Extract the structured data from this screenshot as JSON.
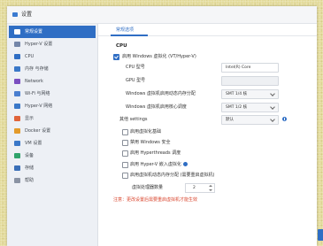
{
  "window": {
    "title": "设置"
  },
  "sidebar": {
    "items": [
      {
        "label": "常规设置",
        "icon": "settings-icon",
        "icon_color": "#ffffff",
        "active": true
      },
      {
        "label": "Hyper-V 设置",
        "icon": "hyperv-icon",
        "icon_color": "#7486a8",
        "active": false
      },
      {
        "label": "CPU",
        "icon": "cpu-icon",
        "icon_color": "#2f6ec4",
        "active": false
      },
      {
        "label": "内存 与存储",
        "icon": "memory-icon",
        "icon_color": "#3a78c8",
        "active": false
      },
      {
        "label": "Network",
        "icon": "network-icon",
        "icon_color": "#7b4fc0",
        "active": false
      },
      {
        "label": "Wi-Fi 与网络",
        "icon": "wifi-icon",
        "icon_color": "#4a7fd0",
        "active": false
      },
      {
        "label": "Hyper-V 网络",
        "icon": "network-adapter-icon",
        "icon_color": "#3a78c8",
        "active": false
      },
      {
        "label": "显示",
        "icon": "display-icon",
        "icon_color": "#e0643a",
        "active": false
      },
      {
        "label": "Docker 设置",
        "icon": "docker-icon",
        "icon_color": "#e39a2a",
        "active": false
      },
      {
        "label": "VM 设置",
        "icon": "vm-icon",
        "icon_color": "#3a78c8",
        "active": false
      },
      {
        "label": "设备",
        "icon": "devices-icon",
        "icon_color": "#2fa36b",
        "active": false
      },
      {
        "label": "存储",
        "icon": "storage-icon",
        "icon_color": "#3a6fb8",
        "active": false
      },
      {
        "label": "帮助",
        "icon": "help-icon",
        "icon_color": "#8a93a3",
        "active": false
      }
    ]
  },
  "main": {
    "tabs": [
      {
        "label": "常规选项",
        "active": true
      }
    ],
    "section_title": "CPU",
    "enable_virtualization": {
      "label": "启用 Windows 虚拟化 (VT/Hyper-V)",
      "checked": true
    },
    "fields": [
      {
        "label": "CPU 型号",
        "value": "Intel(R) Core"
      },
      {
        "label": "GPU 型号",
        "value": ""
      },
      {
        "label": "Windows 虚拟机启用动态内存分配",
        "value": "SMT 1/4 核"
      },
      {
        "label": "Windows 虚拟机启用核心调度",
        "value": "SMT 1/2 核"
      }
    ],
    "other": {
      "label": "其他 settings",
      "value": "默认"
    },
    "options": [
      {
        "label": "启用虚拟化基础",
        "checked": false
      },
      {
        "label": "禁用 Windows 安全",
        "checked": false
      },
      {
        "label": "启用 Hyperthreads 调度",
        "checked": false
      },
      {
        "label": "启用 Hyper-V 嵌入虚拟化",
        "checked": false
      },
      {
        "label": "启用虚拟机动态内存分配 (需要重启虚拟机)",
        "checked": false
      }
    ],
    "vcpu": {
      "label": "虚拟处理器数量",
      "value": "2"
    },
    "note": "注意：更改设置后需要重启虚拟机才能生效"
  },
  "colors": {
    "accent": "#2f6ec4",
    "note": "#d9432b",
    "paper": "#e3db9b"
  }
}
